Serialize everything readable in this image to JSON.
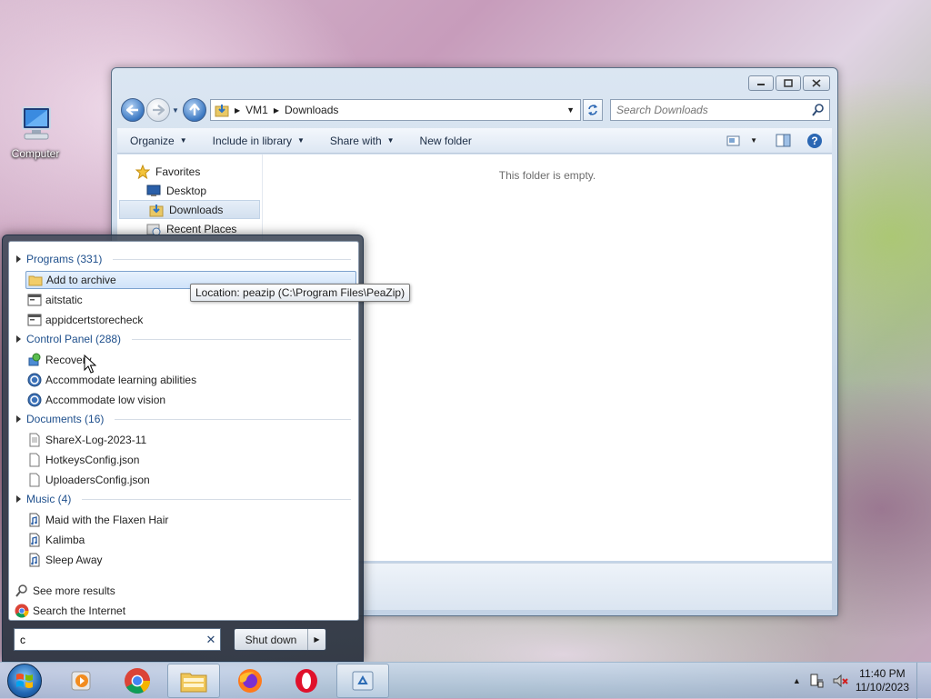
{
  "desktop": {
    "computer_label": "Computer"
  },
  "explorer": {
    "address": {
      "root": "VM1",
      "folder": "Downloads"
    },
    "search_placeholder": "Search Downloads",
    "toolbar": {
      "organize": "Organize",
      "include_library": "Include in library",
      "share_with": "Share with",
      "new_folder": "New folder"
    },
    "nav": {
      "favorites": "Favorites",
      "desktop": "Desktop",
      "downloads": "Downloads",
      "recent_places": "Recent Places"
    },
    "empty_message": "This folder is empty."
  },
  "start_menu": {
    "groups": {
      "programs": "Programs (331)",
      "control_panel": "Control Panel (288)",
      "documents": "Documents (16)",
      "music": "Music (4)"
    },
    "programs": [
      "Add to archive",
      "aitstatic",
      "appidcertstorecheck"
    ],
    "control_panel": [
      "Recovery",
      "Accommodate learning abilities",
      "Accommodate low vision"
    ],
    "documents": [
      "ShareX-Log-2023-11",
      "HotkeysConfig.json",
      "UploadersConfig.json"
    ],
    "music": [
      "Maid with the Flaxen Hair",
      "Kalimba",
      "Sleep Away"
    ],
    "see_more": "See more results",
    "search_internet": "Search the Internet",
    "search_value": "c",
    "shutdown": "Shut down"
  },
  "tooltip": "Location: peazip (C:\\Program Files\\PeaZip)",
  "taskbar": {
    "time": "11:40 PM",
    "date": "11/10/2023"
  }
}
